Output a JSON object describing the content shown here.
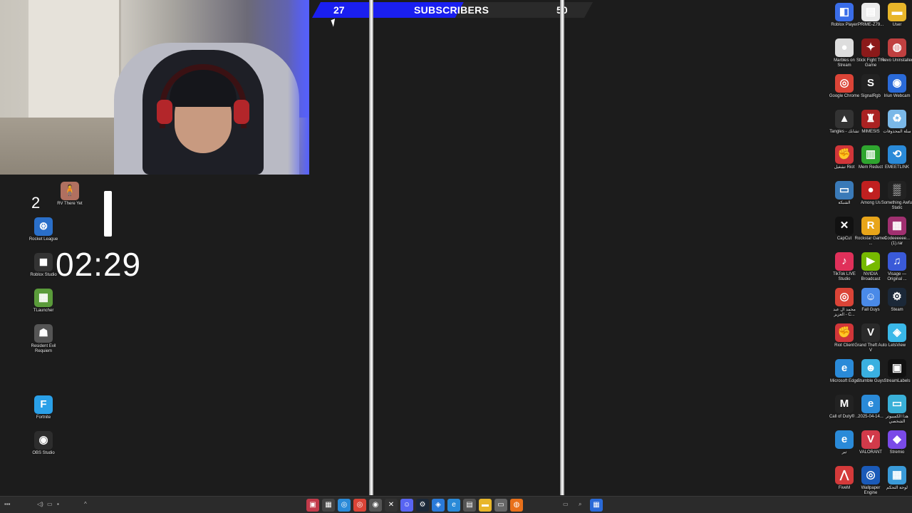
{
  "subscriber_goal": {
    "current": "27",
    "label": "SUBSCRIBERS",
    "goal": "50",
    "progress": 0.54,
    "fill_color": "#1a1ff0"
  },
  "counter": "2",
  "timer": "02:29",
  "left_icons": [
    {
      "name": "rv-there-yet-icon",
      "label": "RV There Yet",
      "glyph": "🧍",
      "color": "#b07060"
    },
    {
      "name": "rocket-league-icon",
      "label": "Rocket League",
      "glyph": "⊛",
      "color": "#2a6fc9"
    },
    {
      "name": "roblox-studio-icon",
      "label": "Roblox Studio",
      "glyph": "◼",
      "color": "#333333"
    },
    {
      "name": "tlauncher-icon",
      "label": "TLauncher",
      "glyph": "▦",
      "color": "#5a9b3a"
    },
    {
      "name": "resident-evil-icon",
      "label": "Resident Evil Requiem",
      "glyph": "☗",
      "color": "#555555"
    },
    {
      "name": "fortnite-icon",
      "label": "Fortnite",
      "glyph": "F",
      "color": "#2aa0e8"
    },
    {
      "name": "obs-studio-icon",
      "label": "OBS Studio",
      "glyph": "◉",
      "color": "#2d2d2d"
    }
  ],
  "right_icons": [
    {
      "name": "roblox-player-icon",
      "label": "Roblox Player",
      "glyph": "◧",
      "color": "#3a6de8"
    },
    {
      "name": "prime-file-icon",
      "label": "PRIME-Z79...",
      "glyph": "▤",
      "color": "#eaeaea"
    },
    {
      "name": "user-folder-icon",
      "label": "User",
      "glyph": "▬",
      "color": "#e8b62a"
    },
    {
      "name": "marbles-icon",
      "label": "Marbles on Stream",
      "glyph": "●",
      "color": "#dddddd"
    },
    {
      "name": "stick-fight-icon",
      "label": "Stick Fight The Game",
      "glyph": "✦",
      "color": "#8b1a1a"
    },
    {
      "name": "revo-uninstaller-icon",
      "label": "Revo Uninstaller",
      "glyph": "◍",
      "color": "#c04040"
    },
    {
      "name": "chrome-icon",
      "label": "Google Chrome",
      "glyph": "◎",
      "color": "#db4437"
    },
    {
      "name": "signalrgb-icon",
      "label": "SignalRgb",
      "glyph": "S",
      "color": "#222222"
    },
    {
      "name": "webcam-icon",
      "label": "Iriun Webcam",
      "glyph": "◉",
      "color": "#2a6ad8"
    },
    {
      "name": "tangles-icon",
      "label": "Tangles - تشابك",
      "glyph": "▲",
      "color": "#333333"
    },
    {
      "name": "mimesis-icon",
      "label": "MIMESIS",
      "glyph": "♜",
      "color": "#aa2222"
    },
    {
      "name": "recycle-bin-icon",
      "label": "سلة المحذوفات",
      "glyph": "♻",
      "color": "#7ab8e8"
    },
    {
      "name": "riot-icon-1",
      "label": "تشغيل Riot",
      "glyph": "✊",
      "color": "#d13639"
    },
    {
      "name": "mem-reduct-icon",
      "label": "Mem Reduct",
      "glyph": "▥",
      "color": "#2fa52f"
    },
    {
      "name": "emeetlink-icon",
      "label": "EMEETLINK",
      "glyph": "⟲",
      "color": "#2a8ad8"
    },
    {
      "name": "network-icon",
      "label": "الشبكة",
      "glyph": "▭",
      "color": "#3a7ab8"
    },
    {
      "name": "among-us-icon",
      "label": "Among Us",
      "glyph": "●",
      "color": "#c02020"
    },
    {
      "name": "something-awful-icon",
      "label": "Something Awful Static",
      "glyph": "▒",
      "color": "#222222"
    },
    {
      "name": "capcut-icon",
      "label": "CapCut",
      "glyph": "✕",
      "color": "#111111"
    },
    {
      "name": "rockstar-icon",
      "label": "Rockstar Games ...",
      "glyph": "R",
      "color": "#e8a51a"
    },
    {
      "name": "rar-file-icon",
      "label": "Codeeeeee... (1).rar",
      "glyph": "▦",
      "color": "#a03070"
    },
    {
      "name": "tiktok-live-icon",
      "label": "TikTok LIVE Studio",
      "glyph": "♪",
      "color": "#e0305a"
    },
    {
      "name": "nvidia-icon",
      "label": "NVIDIA Broadcast",
      "glyph": "▶",
      "color": "#76b900"
    },
    {
      "name": "visage-icon",
      "label": "Visage — Original ...",
      "glyph": "♫",
      "color": "#3a5ad8"
    },
    {
      "name": "chrome-profile-icon",
      "label": "محمد ال عبد العزيز - C...",
      "glyph": "◎",
      "color": "#db4437"
    },
    {
      "name": "fall-guys-icon",
      "label": "Fall Guys",
      "glyph": "☺",
      "color": "#4a8ae8"
    },
    {
      "name": "steam-icon-1",
      "label": "Steam",
      "glyph": "⚙",
      "color": "#1b2838"
    },
    {
      "name": "riot-client-icon",
      "label": "Riot Client",
      "glyph": "✊",
      "color": "#d13639"
    },
    {
      "name": "gta-icon",
      "label": "Grand Theft Auto V",
      "glyph": "V",
      "color": "#2a2a2a"
    },
    {
      "name": "letsview-icon",
      "label": "LetsView",
      "glyph": "◈",
      "color": "#3ab8e8"
    },
    {
      "name": "edge-icon-1",
      "label": "Microsoft Edge",
      "glyph": "e",
      "color": "#2a8ad8"
    },
    {
      "name": "stumble-guys-icon",
      "label": "Stumble Guys",
      "glyph": "☻",
      "color": "#3ab0e0"
    },
    {
      "name": "streamlabels-icon",
      "label": "StreamLabels",
      "glyph": "▣",
      "color": "#111111"
    },
    {
      "name": "cod-icon",
      "label": "Call of Duty® ...",
      "glyph": "M",
      "color": "#222222"
    },
    {
      "name": "edge-icon-2",
      "label": "2025-04-14...",
      "glyph": "e",
      "color": "#2a8ad8"
    },
    {
      "name": "this-pc-icon",
      "label": "هذا الكمبيوتر الشخصي",
      "glyph": "▭",
      "color": "#3ab0d8"
    },
    {
      "name": "edge-icon-3",
      "label": "تير",
      "glyph": "e",
      "color": "#2a8ad8"
    },
    {
      "name": "valorant-icon",
      "label": "VALORANT",
      "glyph": "V",
      "color": "#d13a4a"
    },
    {
      "name": "stremio-icon",
      "label": "Stremio",
      "glyph": "◆",
      "color": "#7a4ae8"
    },
    {
      "name": "fivem-icon",
      "label": "FiveM",
      "glyph": "⋀",
      "color": "#d43a3a"
    },
    {
      "name": "wallpaper-engine-icon",
      "label": "Wallpaper Engine",
      "glyph": "◎",
      "color": "#1a5ab8"
    },
    {
      "name": "control-panel-icon",
      "label": "لوحة التحكم",
      "glyph": "▦",
      "color": "#3a9ad8"
    }
  ],
  "taskbar_apps": [
    {
      "name": "taskbar-app-1",
      "glyph": "▣",
      "color": "#c23a4a"
    },
    {
      "name": "taskbar-app-2",
      "glyph": "▦",
      "color": "#444444"
    },
    {
      "name": "taskbar-app-3",
      "glyph": "◎",
      "color": "#2a8ad8"
    },
    {
      "name": "taskbar-chrome",
      "glyph": "◎",
      "color": "#db4437"
    },
    {
      "name": "taskbar-app-5",
      "glyph": "◉",
      "color": "#555555"
    },
    {
      "name": "taskbar-app-6",
      "glyph": "✕",
      "color": "#333333"
    },
    {
      "name": "taskbar-discord",
      "glyph": "☺",
      "color": "#5865f2"
    },
    {
      "name": "taskbar-steam",
      "glyph": "⚙",
      "color": "#1b2838"
    },
    {
      "name": "taskbar-app-9",
      "glyph": "◈",
      "color": "#2a7ad8"
    },
    {
      "name": "taskbar-edge",
      "glyph": "e",
      "color": "#2a8ad8"
    },
    {
      "name": "taskbar-app-11",
      "glyph": "▤",
      "color": "#555555"
    },
    {
      "name": "taskbar-explorer",
      "glyph": "▬",
      "color": "#e8b62a"
    },
    {
      "name": "taskbar-app-13",
      "glyph": "▭",
      "color": "#666666"
    },
    {
      "name": "taskbar-app-14",
      "glyph": "◍",
      "color": "#e8701a"
    }
  ]
}
